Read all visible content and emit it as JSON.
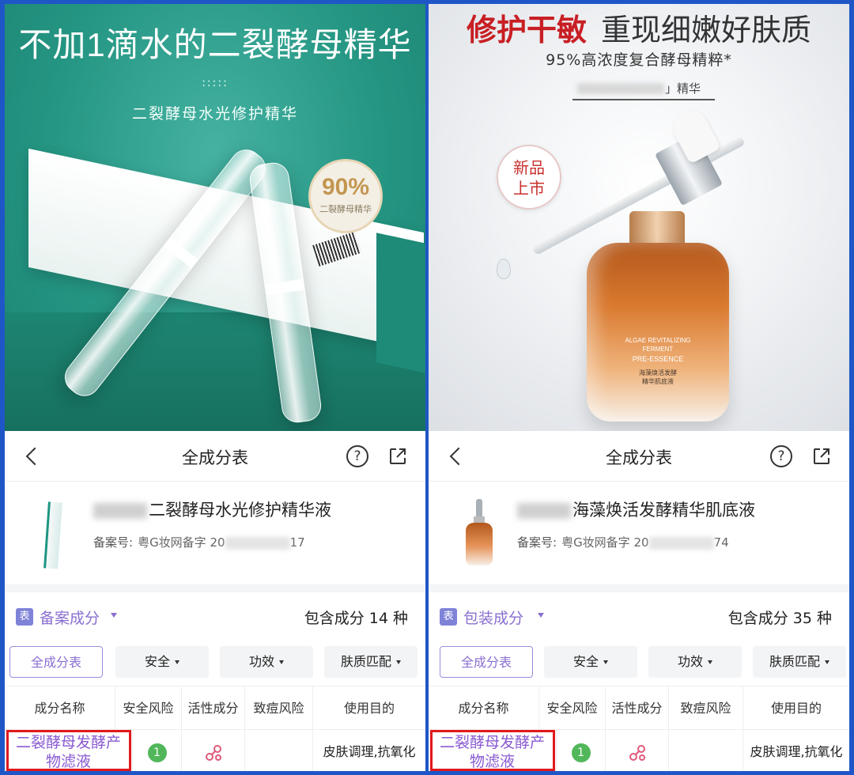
{
  "left": {
    "banner": {
      "title": "不加1滴水的二裂酵母精华",
      "dots": ":::::",
      "subtitle": "二裂酵母水光修护精华",
      "badge_pct": "90%",
      "badge_label": "二裂酵母精华"
    },
    "nav": {
      "title": "全成分表",
      "help": "?"
    },
    "product": {
      "name": "二裂酵母水光修护精华液",
      "reg_label": "备案号:",
      "reg_prefix": "粤G妆网备字 20",
      "reg_suffix": "17"
    },
    "section": {
      "icon": "表",
      "label": "备案成分",
      "count": "包含成分 14 种"
    },
    "filters": [
      "全成分表",
      "安全",
      "功效",
      "肤质匹配"
    ],
    "columns": [
      "成分名称",
      "安全风险",
      "活性成分",
      "致痘风险",
      "使用目的"
    ],
    "row": {
      "name": "二裂酵母发酵产物滤液",
      "risk": "1",
      "purpose": "皮肤调理,抗氧化"
    }
  },
  "right": {
    "banner": {
      "title_red": "修护干敏",
      "title_dark": "重现细嫩好肤质",
      "subtitle": "95%高浓度复合酵母精粹*",
      "brand_suffix": "」精华",
      "new_badge_line1": "新品",
      "new_badge_line2": "上市",
      "bottle_line1": "ALGAE REVITALIZING",
      "bottle_line2": "FERMENT",
      "bottle_line3": "PRE-ESSENCE",
      "bottle_cn1": "海藻焕活发酵",
      "bottle_cn2": "精华肌底液"
    },
    "nav": {
      "title": "全成分表",
      "help": "?"
    },
    "product": {
      "name": "海藻焕活发酵精华肌底液",
      "reg_label": "备案号:",
      "reg_prefix": "粤G妆网备字 20",
      "reg_suffix": "74"
    },
    "section": {
      "icon": "表",
      "label": "包装成分",
      "count": "包含成分 35 种"
    },
    "filters": [
      "全成分表",
      "安全",
      "功效",
      "肤质匹配"
    ],
    "columns": [
      "成分名称",
      "安全风险",
      "活性成分",
      "致痘风险",
      "使用目的"
    ],
    "row": {
      "name": "二裂酵母发酵产物滤液",
      "risk": "1",
      "purpose": "皮肤调理,抗氧化"
    }
  },
  "colors": {
    "frame": "#1f56c7",
    "accent_purple": "#8a6fd1",
    "highlight_red": "#e0191c",
    "risk_green": "#52b75a",
    "banner_teal": "#259683",
    "title_red": "#c81f24"
  },
  "icons": [
    "back-icon",
    "help-icon",
    "share-icon",
    "table-icon",
    "dropdown-caret-icon",
    "active-ingredient-icon"
  ]
}
